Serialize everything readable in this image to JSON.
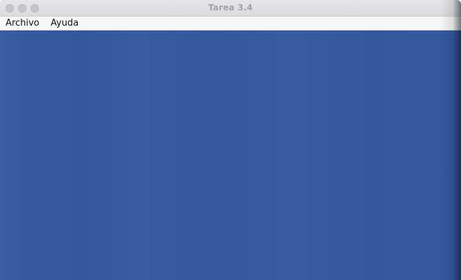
{
  "window": {
    "title": "Tarea 3.4"
  },
  "menubar": {
    "items": [
      {
        "label": "Archivo"
      },
      {
        "label": "Ayuda"
      }
    ]
  },
  "colors": {
    "canvas_background": "#36589f",
    "menubar_background": "#f6f6f7",
    "titlebar_background": "#e0e0e2"
  }
}
